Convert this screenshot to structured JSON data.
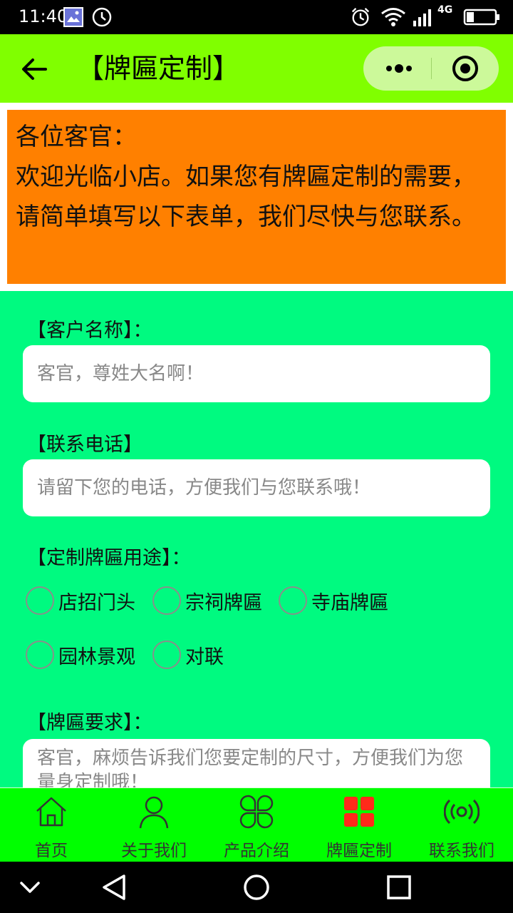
{
  "status_bar": {
    "time": "11:40",
    "network": "4G",
    "icons": [
      "gallery-icon",
      "clock-icon",
      "alarm-icon",
      "wifi-icon",
      "signal-icon",
      "battery-icon"
    ]
  },
  "header": {
    "title": "【牌匾定制】",
    "back_icon": "back-arrow-icon",
    "capsule_icons": [
      "more-dots-icon",
      "target-icon"
    ]
  },
  "notice": {
    "greeting": "各位客官：",
    "message": "欢迎光临小店。如果您有牌匾定制的需要，请简单填写以下表单，我们尽快与您联系。"
  },
  "form": {
    "name_label": "【客户名称】：",
    "name_placeholder": "客官，尊姓大名啊！",
    "phone_label": "【联系电话】",
    "phone_placeholder": "请留下您的电话，方便我们与您联系哦！",
    "purpose_label": "【定制牌匾用途】：",
    "purpose_options": [
      "店招门头",
      "宗祠牌匾",
      "寺庙牌匾",
      "园林景观",
      "对联"
    ],
    "requirements_label": "【牌匾要求】：",
    "requirements_placeholder": "客官，麻烦告诉我们您要定制的尺寸，方便我们为您量身定制哦！"
  },
  "tabbar": {
    "items": [
      {
        "label": "首页",
        "icon": "home-icon",
        "active": false
      },
      {
        "label": "关于我们",
        "icon": "user-icon",
        "active": false
      },
      {
        "label": "产品介绍",
        "icon": "clover-icon",
        "active": false
      },
      {
        "label": "牌匾定制",
        "icon": "grid-icon",
        "active": true
      },
      {
        "label": "联系我们",
        "icon": "broadcast-icon",
        "active": false
      }
    ],
    "active_color": "#ff2a1a",
    "inactive_color": "#333333"
  },
  "colors": {
    "header_bg": "#80ff00",
    "notice_bg": "#ff8000",
    "form_bg": "#00fa80",
    "tabbar_bg": "#00ff00"
  }
}
